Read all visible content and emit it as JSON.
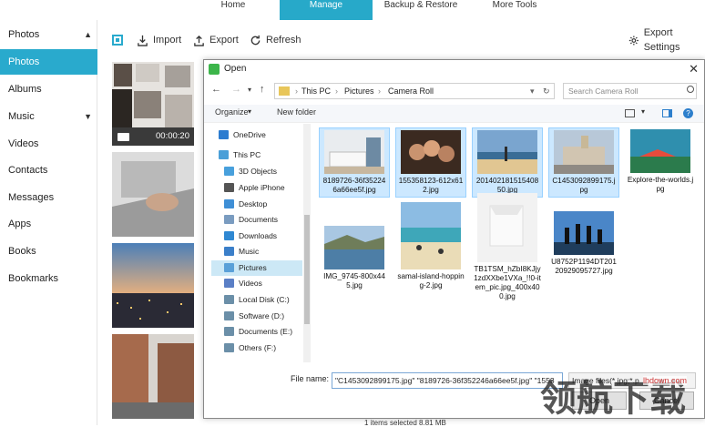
{
  "header": {
    "tabs": [
      {
        "label": "Home"
      },
      {
        "label": "Manage",
        "active": true
      },
      {
        "label": "Backup & Restore"
      },
      {
        "label": "More Tools"
      }
    ]
  },
  "sidebar": {
    "items": [
      {
        "label": "Photos",
        "chevron": "▲"
      },
      {
        "label": "Photos",
        "active": true
      },
      {
        "label": "Albums"
      },
      {
        "label": "Music",
        "chevron": "▼"
      },
      {
        "label": "Videos"
      },
      {
        "label": "Contacts"
      },
      {
        "label": "Messages"
      },
      {
        "label": "Apps"
      },
      {
        "label": "Books"
      },
      {
        "label": "Bookmarks"
      }
    ]
  },
  "toolbar": {
    "import_label": "Import",
    "export_label": "Export",
    "refresh_label": "Refresh",
    "export_settings_label": "Export Settings"
  },
  "video_duration": "00:00:20",
  "dialog": {
    "title": "Open",
    "close": "✕",
    "address": [
      "This PC",
      "Pictures",
      "Camera Roll"
    ],
    "search_placeholder": "Search Camera Roll",
    "organize_label": "Organize",
    "new_folder_label": "New folder",
    "nav_items": [
      {
        "label": "OneDrive",
        "icon": "cloud-icon",
        "color": "#2c7cd0"
      },
      {
        "label": "This PC",
        "icon": "pc-icon",
        "color": "#4a9fd8"
      },
      {
        "label": "3D Objects",
        "icon": "cube-icon",
        "color": "#48a0dc"
      },
      {
        "label": "Apple iPhone",
        "icon": "phone-icon",
        "color": "#555555"
      },
      {
        "label": "Desktop",
        "icon": "desktop-icon",
        "color": "#3f8fd6"
      },
      {
        "label": "Documents",
        "icon": "documents-icon",
        "color": "#7a9cc0"
      },
      {
        "label": "Downloads",
        "icon": "download-icon",
        "color": "#2f88d2"
      },
      {
        "label": "Music",
        "icon": "music-icon",
        "color": "#3b7fc9"
      },
      {
        "label": "Pictures",
        "icon": "pictures-icon",
        "color": "#5aa0d8",
        "active": true
      },
      {
        "label": "Videos",
        "icon": "videos-icon",
        "color": "#5a7fc6"
      },
      {
        "label": "Local Disk (C:)",
        "icon": "disk-icon",
        "color": "#6b8fa8"
      },
      {
        "label": "Software (D:)",
        "icon": "disk-icon",
        "color": "#6b8fa8"
      },
      {
        "label": "Documents (E:)",
        "icon": "disk-icon",
        "color": "#6b8fa8"
      },
      {
        "label": "Others (F:)",
        "icon": "disk-icon",
        "color": "#6b8fa8"
      }
    ],
    "files": [
      {
        "name": "8189726-36f352246a66ee5f.jpg",
        "selected": true
      },
      {
        "name": "155358123-612x612.jpg",
        "selected": true
      },
      {
        "name": "20140218151540850.jpg",
        "selected": true
      },
      {
        "name": "C1453092899175.jpg",
        "selected": true
      },
      {
        "name": "Explore-the-worlds.jpg",
        "selected": false
      },
      {
        "name": "IMG_9745-800x445.jpg",
        "selected": false
      },
      {
        "name": "samal-island-hopping-2.jpg",
        "selected": false
      },
      {
        "name": "TB1TSM_hZbI8KJjy1zdXXbe1VXa_!!0-item_pic.jpg_400x400.jpg",
        "selected": false
      },
      {
        "name": "U8752P1194DT20120929095727.jpg",
        "selected": false
      }
    ],
    "file_name_label": "File name:",
    "file_name_value": "\"C1453092899175.jpg\" \"8189726-36f352246a66ee5f.jpg\" \"1553",
    "file_type_value": "Image files(*.jpg;*.p",
    "open_label": "Open",
    "cancel_label": "Cancel"
  },
  "status_text": "1 items selected 8.81 MB",
  "watermark": {
    "text": "领航下载",
    "sub": "lhdown.com"
  }
}
